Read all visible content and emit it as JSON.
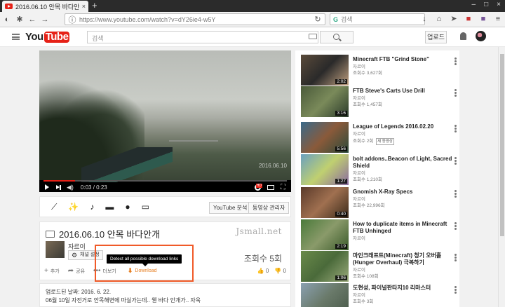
{
  "browser": {
    "tab_title": "2016.06.10 안목 바다안개",
    "tab_close": "×",
    "new_tab": "+",
    "url": "https://www.youtube.com/watch?v=dY26ie4-w5Y",
    "search_placeholder": "검색",
    "window_controls": [
      "–",
      "□",
      "×"
    ],
    "search_engine_badge": "G"
  },
  "masthead": {
    "logo_you": "You",
    "logo_tube": "Tube",
    "search_placeholder": "검색",
    "upload_label": "업로드"
  },
  "player": {
    "time": "0:03 / 0:23",
    "watermark": "2016.06.10",
    "progress": 0.13,
    "hd_badge": "HD"
  },
  "edit_bar": {
    "icons": [
      "wand-icon",
      "sparkle-wand-icon",
      "music-note-icon",
      "speech-bubble-icon",
      "info-icon",
      "caption-icon"
    ],
    "analytics_label": "YouTube 분석",
    "manager_label": "동영상 관리자"
  },
  "video_info": {
    "title": "2016.06.10 안목 바다안개",
    "watermark_text": "Jsmall.net",
    "channel_name": "자르이",
    "channel_button": "채널 설정",
    "views": "조회수 5회",
    "tooltip": "Detect all possible download links",
    "actions": {
      "add": "추가",
      "share": "공유",
      "more": "더보기",
      "download": "Download"
    },
    "likes": "0",
    "dislikes": "0"
  },
  "description": {
    "date": "업로드된 날짜: 2016. 6. 22.",
    "text": "06월 10일 자전거로 안목해변에 마실가는데.. 웬 바다 안개가.. 자욱"
  },
  "sidebar": {
    "items": [
      {
        "title": "Minecraft FTB \"Grind Stone\"",
        "channel": "자르이",
        "views": "조회수 3,627회",
        "duration": "2:02",
        "new": false
      },
      {
        "title": "FTB Steve's Carts Use Drill",
        "channel": "자르이",
        "views": "조회수 1,457회",
        "duration": "3:16",
        "new": false
      },
      {
        "title": "League of Legends 2016.02.20",
        "channel": "자르이",
        "views": "조회수 2회",
        "duration": "5:56",
        "new": true,
        "new_label": "새 동영상"
      },
      {
        "title": "bolt addons..Beacon of Light, Sacred Shield",
        "channel": "자르이",
        "views": "조회수 1,210회",
        "duration": "1:27",
        "new": false
      },
      {
        "title": "Gnomish X-Ray Specs",
        "channel": "자르이",
        "views": "조회수 22,996회",
        "duration": "0:40",
        "new": false
      },
      {
        "title": "How to duplicate items in Minecraft FTB Unhinged",
        "channel": "자르이",
        "views": "",
        "duration": "2:19",
        "new": false
      },
      {
        "title": "마인크래프트(Minecraft) 청기 오버홀 (Hunger Overhaul) 극복하기",
        "channel": "자르이",
        "views": "조회수 108회",
        "duration": "1:06",
        "new": false
      },
      {
        "title": "도현성, 파이널판타지10 리마스터",
        "channel": "자르이",
        "views": "조회수 3회",
        "duration": "",
        "new": false
      }
    ]
  }
}
